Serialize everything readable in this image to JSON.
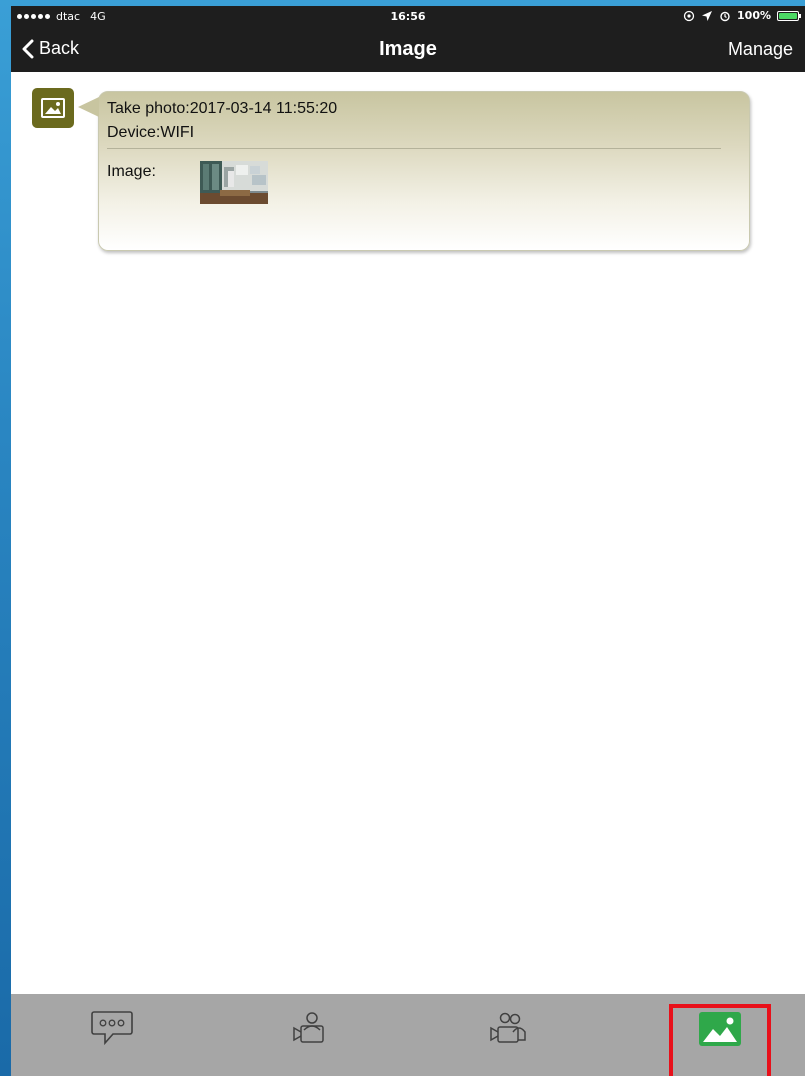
{
  "status_bar": {
    "carrier": "dtac",
    "network": "4G",
    "time": "16:56",
    "battery": "100%",
    "battery_color": "#4cd964"
  },
  "nav": {
    "back_label": "Back",
    "title": "Image",
    "manage_label": "Manage"
  },
  "message": {
    "avatar_icon": "image-icon",
    "avatar_color": "#6b6a1e",
    "take_photo": "Take photo:2017-03-14 11:55:20",
    "device": "Device:WIFI",
    "image_label": "Image:"
  },
  "tabs": [
    {
      "icon": "chat-bubble-icon"
    },
    {
      "icon": "video-camera-person-icon"
    },
    {
      "icon": "video-camera-group-icon"
    },
    {
      "icon": "image-icon",
      "active_color": "#2fa84a",
      "highlight_color": "#e8101a"
    }
  ]
}
